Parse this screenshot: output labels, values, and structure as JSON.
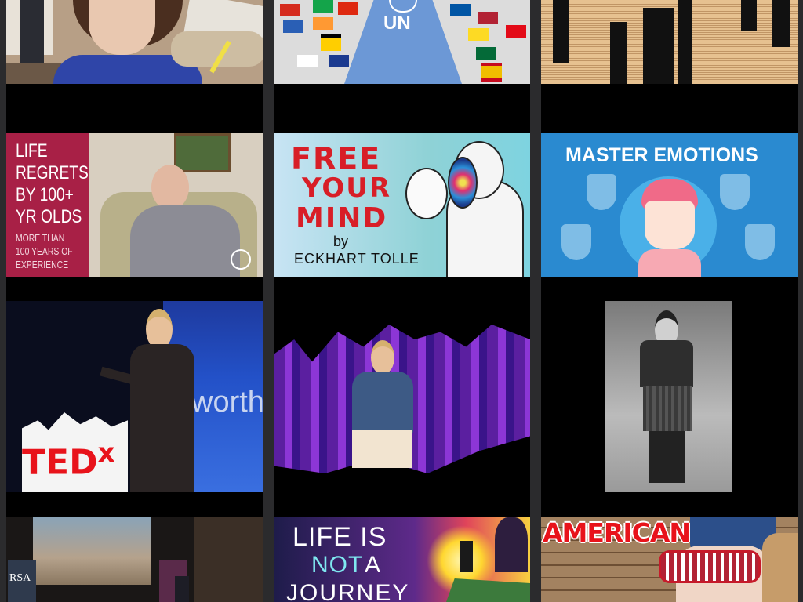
{
  "thumbnails": [
    {
      "id": "child-reading"
    },
    {
      "id": "un-flags",
      "text": "UN"
    },
    {
      "id": "skyline-names"
    },
    {
      "id": "life-regrets",
      "lines": [
        "LIFE",
        "REGRETS",
        "BY 100+",
        "YR OLDS"
      ],
      "sub": [
        "MORE THAN",
        "100 YEARS OF",
        "EXPERIENCE"
      ]
    },
    {
      "id": "free-your-mind",
      "lines": [
        "FREE",
        "YOUR",
        "MIND"
      ],
      "by": "by",
      "author": "ECKHART TOLLE"
    },
    {
      "id": "master-emotions",
      "title": "MASTER EMOTIONS"
    },
    {
      "id": "tedx-talk",
      "brand": "TED",
      "brand_x": "x",
      "wall": "worth"
    },
    {
      "id": "ted-stage"
    },
    {
      "id": "kilt-photo"
    },
    {
      "id": "rsa-lecture",
      "brand": "RSA"
    },
    {
      "id": "life-not-journey",
      "lines": [
        "LIFE IS",
        "NOT",
        "A",
        "JOURNEY"
      ]
    },
    {
      "id": "american",
      "title": "AMERICAN"
    }
  ],
  "colors": {
    "background": "#2b2b2d",
    "tile": "#000000",
    "accent_red": "#e8131b"
  }
}
